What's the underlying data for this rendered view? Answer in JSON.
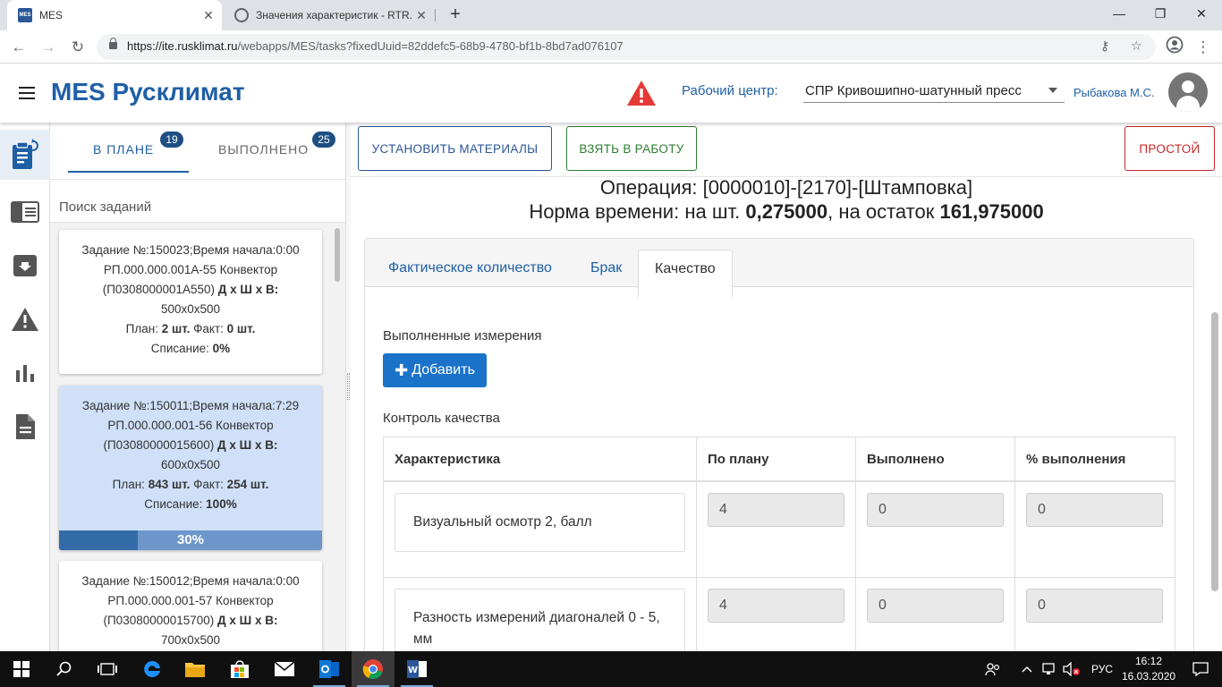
{
  "browser": {
    "tabs": [
      {
        "title": "MES",
        "active": true,
        "favicon": "MES"
      },
      {
        "title": "Значения характеристик - RTR. |",
        "active": false
      }
    ],
    "url_host": "https://ite.rusklimat.ru",
    "url_path": "/webapps/MES/tasks?fixedUuid=82ddefc5-68b9-4780-bf1b-8bd7ad076107"
  },
  "header": {
    "title": "MES Русклимат",
    "work_center_label": "Рабочий центр:",
    "work_center_value": "СПР Кривошипно-шатунный пресс",
    "user_name": "Рыбакова М.С."
  },
  "rail": {
    "items": [
      "tasks-icon",
      "panel-icon",
      "archive-icon",
      "warning-icon",
      "chart-icon",
      "document-icon"
    ]
  },
  "tasks_panel": {
    "tab_plan": "В ПЛАНЕ",
    "tab_plan_count": "19",
    "tab_done": "ВЫПОЛНЕНО",
    "tab_done_count": "25",
    "search_label": "Поиск заданий",
    "cards": [
      {
        "line1": "Задание №:150023;Время начала:0:00",
        "line2": "РП.000.000.001А-55 Конвектор",
        "line3_prefix": "(П0308000001А550) ",
        "dims_label": "Д x Ш x В:",
        "dims": "500x0x500",
        "plan_label": "План: ",
        "plan": "2 шт.",
        "fact_label": " Факт: ",
        "fact": "0 шт.",
        "writeoff_label": "Списание: ",
        "writeoff": "0%"
      },
      {
        "line1": "Задание №:150011;Время начала:7:29",
        "line2": "РП.000.000.001-56 Конвектор",
        "line3_prefix": "(П03080000015600) ",
        "dims_label": "Д x Ш x В:",
        "dims": "600x0x500",
        "plan_label": "План: ",
        "plan": "843 шт.",
        "fact_label": " Факт: ",
        "fact": "254 шт.",
        "writeoff_label": "Списание: ",
        "writeoff": "100%",
        "progress_text": "30%",
        "progress_fraction": 0.3
      },
      {
        "line1": "Задание №:150012;Время начала:0:00",
        "line2": "РП.000.000.001-57 Конвектор",
        "line3_prefix": "(П03080000015700) ",
        "dims_label": "Д x Ш x В:",
        "dims": "700x0x500"
      }
    ]
  },
  "main": {
    "btn_materials": "УСТАНОВИТЬ МАТЕРИАЛЫ",
    "btn_take": "ВЗЯТЬ В РАБОТУ",
    "btn_idle": "ПРОСТОЙ",
    "operation_label": "Операция: ",
    "operation_value": "[0000010]-[2170]-[Штамповка]",
    "norm_prefix": "Норма времени: на шт. ",
    "norm_per_unit": "0,275000",
    "norm_mid": ", на остаток ",
    "norm_remaining": "161,975000",
    "tabs": [
      "Фактическое количество",
      "Брак",
      "Качество"
    ],
    "active_tab": "Качество",
    "done_measurements_label": "Выполненные измерения",
    "add_button": "Добавить",
    "quality_control_label": "Контроль качества",
    "table": {
      "headers": [
        "Характеристика",
        "По плану",
        "Выполнено",
        "% выполнения"
      ],
      "rows": [
        {
          "name": "Визуальный осмотр 2, балл",
          "plan": "4",
          "done": "0",
          "percent": "0"
        },
        {
          "name": "Разность измерений диагоналей 0 - 5, мм",
          "plan": "4",
          "done": "0",
          "percent": "0"
        }
      ]
    }
  },
  "taskbar": {
    "language": "РУС",
    "time": "16:12",
    "date": "16.03.2020"
  },
  "colors": {
    "brand": "#1f5fa6",
    "btn_materials_border": "#2b5797",
    "btn_take_border": "#2e7d32",
    "btn_idle_border": "#c62828",
    "add_button": "#1a73c9",
    "selected_card": "#cfe0f8",
    "progress_fill": "#336ba8",
    "warning": "#e53935"
  }
}
